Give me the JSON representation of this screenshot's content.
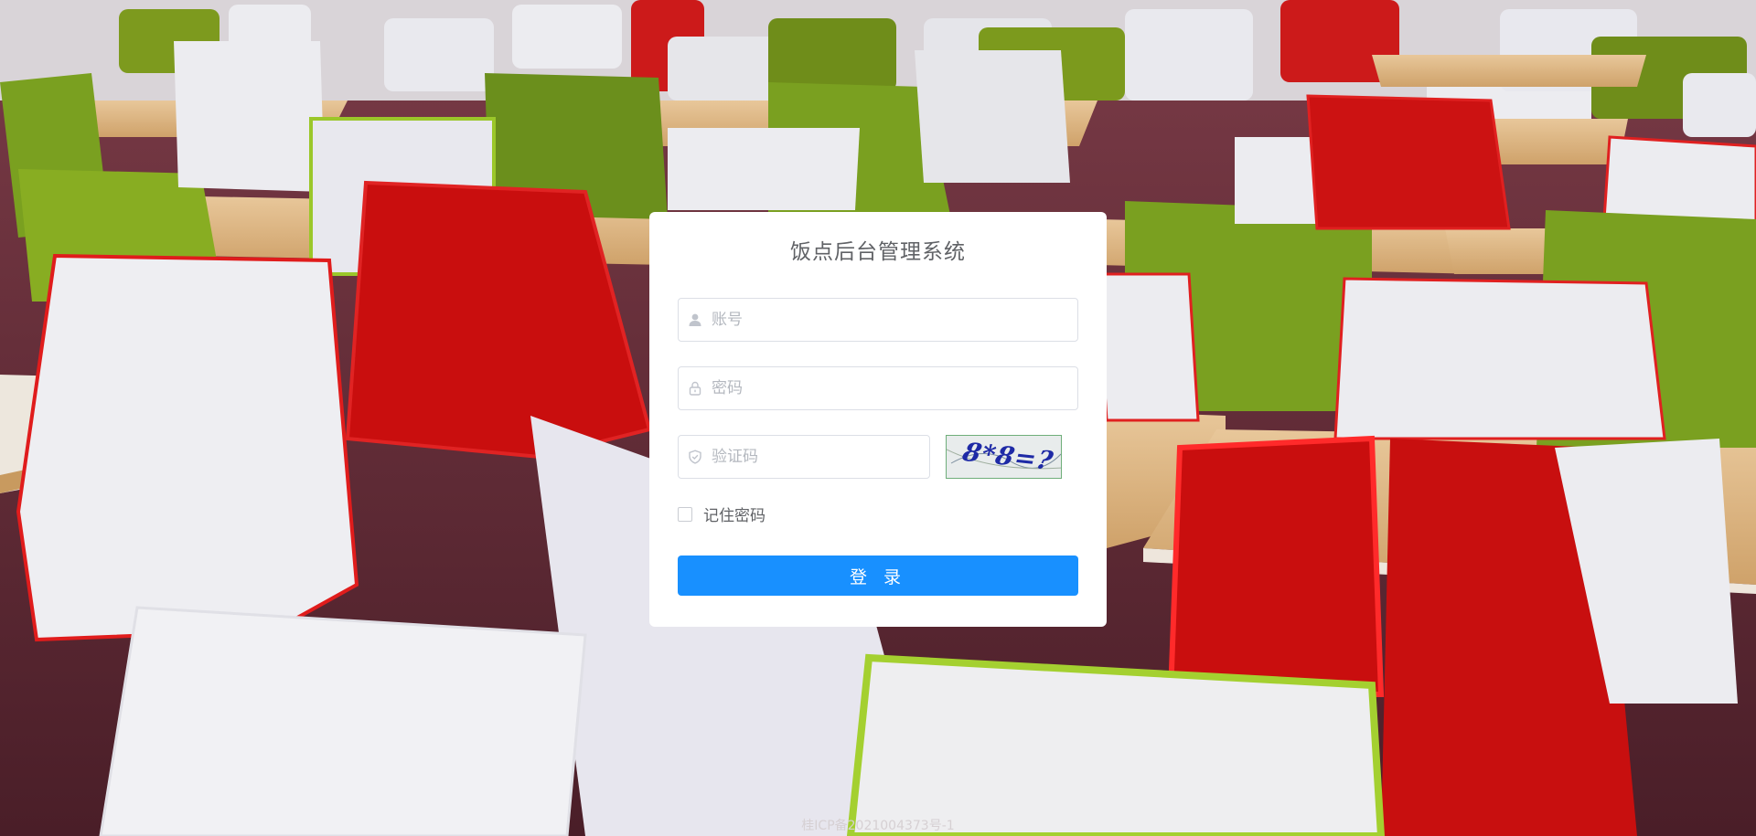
{
  "login": {
    "title": "饭点后台管理系统",
    "username_placeholder": "账号",
    "password_placeholder": "密码",
    "captcha_placeholder": "验证码",
    "captcha_text": "8*8=?",
    "remember_label": "记住密码",
    "remember_checked": false,
    "submit_label": "登 录"
  },
  "footer": {
    "icp": "桂ICP备2021004373号-1"
  },
  "icons": {
    "username": "user-icon",
    "password": "lock-icon",
    "captcha": "shield-check-icon"
  },
  "colors": {
    "primary": "#1890ff",
    "card_bg": "#ffffff",
    "title_text": "#606266",
    "placeholder": "#b4b8bf"
  }
}
